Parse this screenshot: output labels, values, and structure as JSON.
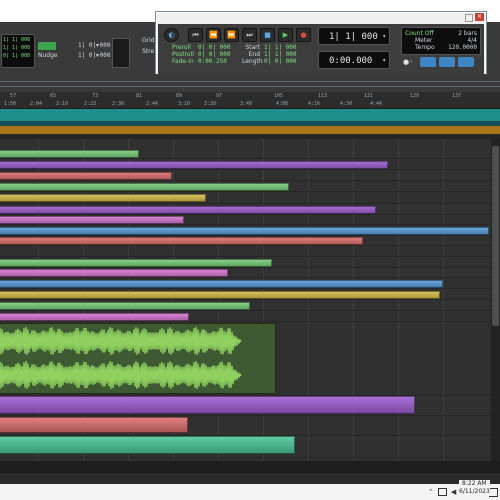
{
  "edit_toolbar": {
    "counter_main_lines": [
      "1| 1| 000",
      "1| 1| 000",
      "0| 1| 000"
    ],
    "grid_label": "Grid",
    "grid_value": "1| 0| 000",
    "nudge_label": "Nudge",
    "nudge_value": "1| 0| 000",
    "abbrev_1": "Grid",
    "abbrev_2": "Stre"
  },
  "transport": {
    "preroll_label": "Preroll",
    "preroll_value": "0| 0| 000",
    "postroll_label": "Postroll",
    "postroll_value": "0| 0| 000",
    "fadein_label": "Fade-in",
    "fadein_value": "0:00.250",
    "start_label": "Start",
    "start_value": "1| 1| 000",
    "end_label": "End",
    "end_value": "1| 1| 000",
    "length_label": "Length",
    "length_value": "0| 0| 000",
    "main_counter": "1| 1| 000",
    "sub_counter": "0:00.000",
    "countoff_label": "Count Off",
    "countoff_value": "2 bars",
    "meter_label": "Meter",
    "meter_value": "4/4",
    "tempo_label": "Tempo",
    "tempo_value": "120.0000"
  },
  "ruler": {
    "bar_numbers": [
      "57",
      "65",
      "73",
      "81",
      "89",
      "97",
      "105",
      "113",
      "121",
      "129",
      "137"
    ],
    "timecodes": [
      "1:50",
      "2:04",
      "2:10",
      "2:23",
      "2:30",
      "2:44",
      "3:10",
      "3:20",
      "3:49",
      "4:08",
      "4:16",
      "4:30",
      "4:44"
    ]
  },
  "tracks": [
    {
      "color": "#7ad17a"
    },
    {
      "color": "#a15fd3"
    },
    {
      "color": "#e07070"
    },
    {
      "color": "#7ad17a"
    },
    {
      "color": "#d8c04a"
    },
    {
      "color": "#a15fd3"
    },
    {
      "color": "#d97ad6"
    },
    {
      "color": "#5a9fe0"
    },
    {
      "color": "#e07070"
    },
    {
      "color": "#7ad17a"
    },
    {
      "color": "#d97ad6"
    },
    {
      "color": "#5a9fe0"
    },
    {
      "color": "#d8c04a"
    },
    {
      "color": "#7ad17a"
    },
    {
      "color": "#d97ad6"
    },
    {
      "color": "#a15fd3"
    },
    {
      "color": "#e07070"
    },
    {
      "color": "#4bc79a"
    }
  ],
  "taskbar": {
    "time": "8:22 AM",
    "date": "6/11/2023"
  },
  "colors": {
    "green": "#7ad17a",
    "purple": "#a15fd3",
    "red": "#e07070",
    "yellow": "#d8c04a",
    "pink": "#d97ad6",
    "blue": "#5a9fe0",
    "teal": "#4bc79a",
    "marker_teal": "#1f8f8c",
    "marker_orange": "#a87518"
  }
}
